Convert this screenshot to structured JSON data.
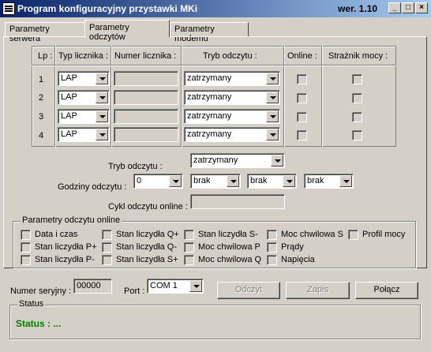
{
  "window": {
    "title": "Program konfiguracyjny przystawki MKi",
    "version": "wer. 1.10",
    "controls": {
      "minimize": "_",
      "maximize": "□",
      "close": "×"
    }
  },
  "tabs": [
    {
      "label": "Parametry serwera",
      "active": false
    },
    {
      "label": "Parametry odczytów",
      "active": true
    },
    {
      "label": "Parametry modemu",
      "active": false
    }
  ],
  "table": {
    "headers": [
      "Lp :",
      "Typ licznika :",
      "Numer licznika :",
      "Tryb odczytu :",
      "Online :",
      "Strażnik mocy :"
    ],
    "rows": [
      {
        "lp": "1",
        "typ": "LAP",
        "numer": "",
        "tryb": "zatrzymany",
        "online": false,
        "straznik": false
      },
      {
        "lp": "2",
        "typ": "LAP",
        "numer": "",
        "tryb": "zatrzymany",
        "online": false,
        "straznik": false
      },
      {
        "lp": "3",
        "typ": "LAP",
        "numer": "",
        "tryb": "zatrzymany",
        "online": false,
        "straznik": false
      },
      {
        "lp": "4",
        "typ": "LAP",
        "numer": "",
        "tryb": "zatrzymany",
        "online": false,
        "straznik": false
      }
    ]
  },
  "settings": {
    "tryb_label": "Tryb odczytu :",
    "tryb_value": "zatrzymany",
    "godziny_label": "Godziny odczytu :",
    "godziny_values": [
      "0",
      "brak",
      "brak",
      "brak"
    ],
    "cykl_label": "Cykl odczytu online :",
    "cykl_value": ""
  },
  "online_params": {
    "title": "Parametry odczytu online",
    "items": [
      "Data i czas",
      "Stan liczydła Q+",
      "Stan liczydła S-",
      "Moc chwilowa S",
      "Profil mocy",
      "Stan liczydła P+",
      "Stan liczydła Q-",
      "Moc chwilowa P",
      "Prądy",
      "Stan liczydła P-",
      "Stan liczydła S+",
      "Moc chwilowa Q",
      "Napięcia"
    ]
  },
  "bottom": {
    "serial_label": "Numer seryjny :",
    "serial_value": "00000",
    "port_label": "Port :",
    "port_value": "COM 1",
    "read_button": "Odczyt",
    "save_button": "Zapis",
    "connect_button": "Połącz"
  },
  "status": {
    "group_title": "Status",
    "text": "Status : ..."
  },
  "colors": {
    "titlebar_start": "#0a246a",
    "titlebar_end": "#a6caf0",
    "status_text": "#008000",
    "face": "#d4d0c8"
  }
}
